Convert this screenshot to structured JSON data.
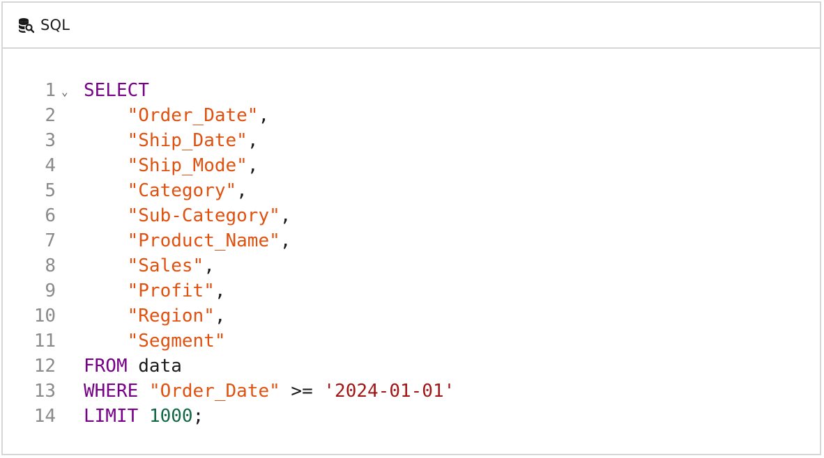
{
  "header": {
    "title": "SQL",
    "icon": "database-search-icon"
  },
  "colors": {
    "keyword": "#770088",
    "identifier": "#e0500e",
    "string": "#a31515",
    "number": "#116644",
    "line_number": "#8a8a8a",
    "border": "#d6d6d6"
  },
  "editor": {
    "fold_glyph": "⌄",
    "lines": [
      {
        "n": "1",
        "tokens": [
          {
            "t": "SELECT",
            "c": "kw"
          }
        ]
      },
      {
        "n": "2",
        "tokens": [
          {
            "t": "    ",
            "c": "plain"
          },
          {
            "t": "\"Order_Date\"",
            "c": "col"
          },
          {
            "t": ",",
            "c": "plain"
          }
        ]
      },
      {
        "n": "3",
        "tokens": [
          {
            "t": "    ",
            "c": "plain"
          },
          {
            "t": "\"Ship_Date\"",
            "c": "col"
          },
          {
            "t": ",",
            "c": "plain"
          }
        ]
      },
      {
        "n": "4",
        "tokens": [
          {
            "t": "    ",
            "c": "plain"
          },
          {
            "t": "\"Ship_Mode\"",
            "c": "col"
          },
          {
            "t": ",",
            "c": "plain"
          }
        ]
      },
      {
        "n": "5",
        "tokens": [
          {
            "t": "    ",
            "c": "plain"
          },
          {
            "t": "\"Category\"",
            "c": "col"
          },
          {
            "t": ",",
            "c": "plain"
          }
        ]
      },
      {
        "n": "6",
        "tokens": [
          {
            "t": "    ",
            "c": "plain"
          },
          {
            "t": "\"Sub-Category\"",
            "c": "col"
          },
          {
            "t": ",",
            "c": "plain"
          }
        ]
      },
      {
        "n": "7",
        "tokens": [
          {
            "t": "    ",
            "c": "plain"
          },
          {
            "t": "\"Product_Name\"",
            "c": "col"
          },
          {
            "t": ",",
            "c": "plain"
          }
        ]
      },
      {
        "n": "8",
        "tokens": [
          {
            "t": "    ",
            "c": "plain"
          },
          {
            "t": "\"Sales\"",
            "c": "col"
          },
          {
            "t": ",",
            "c": "plain"
          }
        ]
      },
      {
        "n": "9",
        "tokens": [
          {
            "t": "    ",
            "c": "plain"
          },
          {
            "t": "\"Profit\"",
            "c": "col"
          },
          {
            "t": ",",
            "c": "plain"
          }
        ]
      },
      {
        "n": "10",
        "tokens": [
          {
            "t": "    ",
            "c": "plain"
          },
          {
            "t": "\"Region\"",
            "c": "col"
          },
          {
            "t": ",",
            "c": "plain"
          }
        ]
      },
      {
        "n": "11",
        "tokens": [
          {
            "t": "    ",
            "c": "plain"
          },
          {
            "t": "\"Segment\"",
            "c": "col"
          }
        ]
      },
      {
        "n": "12",
        "tokens": [
          {
            "t": "FROM",
            "c": "kw"
          },
          {
            "t": " data",
            "c": "plain"
          }
        ]
      },
      {
        "n": "13",
        "tokens": [
          {
            "t": "WHERE",
            "c": "kw"
          },
          {
            "t": " ",
            "c": "plain"
          },
          {
            "t": "\"Order_Date\"",
            "c": "col"
          },
          {
            "t": " >= ",
            "c": "plain"
          },
          {
            "t": "'2024-01-01'",
            "c": "lit"
          }
        ]
      },
      {
        "n": "14",
        "tokens": [
          {
            "t": "LIMIT",
            "c": "kw"
          },
          {
            "t": " ",
            "c": "plain"
          },
          {
            "t": "1000",
            "c": "num"
          },
          {
            "t": ";",
            "c": "plain"
          }
        ]
      }
    ]
  }
}
